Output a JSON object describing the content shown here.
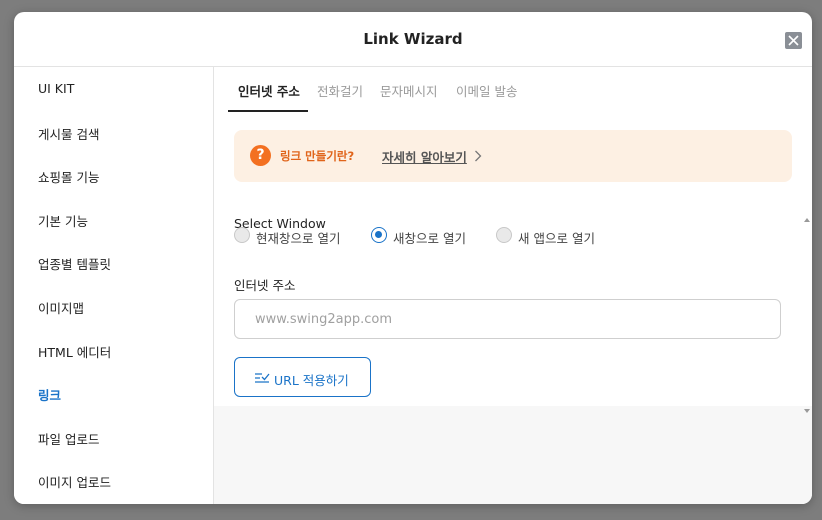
{
  "dialog": {
    "title": "Link Wizard",
    "close_icon": "close-icon"
  },
  "sidebar": {
    "items": [
      {
        "label": "UI KIT",
        "active": false
      },
      {
        "label": "게시물 검색",
        "active": false
      },
      {
        "label": "쇼핑몰 기능",
        "active": false
      },
      {
        "label": "기본 기능",
        "active": false
      },
      {
        "label": "업종별 템플릿",
        "active": false
      },
      {
        "label": "이미지맵",
        "active": false
      },
      {
        "label": "HTML 에디터",
        "active": false
      },
      {
        "label": "링크",
        "active": true
      },
      {
        "label": "파일 업로드",
        "active": false
      },
      {
        "label": "이미지 업로드",
        "active": false
      }
    ]
  },
  "tabs": [
    {
      "label": "인터넷 주소",
      "active": true
    },
    {
      "label": "전화걸기",
      "active": false
    },
    {
      "label": "문자메시지",
      "active": false
    },
    {
      "label": "이메일 발송",
      "active": false
    }
  ],
  "notice": {
    "icon": "question-icon",
    "text": "링크 만들기란?",
    "link": "자세히 알아보기",
    "chevron_icon": "chevron-right-icon"
  },
  "select_window": {
    "label": "Select Window",
    "options": [
      {
        "label": "현재창으로 열기",
        "checked": false
      },
      {
        "label": "새창으로 열기",
        "checked": true
      },
      {
        "label": "새 앱으로 열기",
        "checked": false
      }
    ]
  },
  "url": {
    "label": "인터넷 주소",
    "placeholder": "www.swing2app.com",
    "value": ""
  },
  "apply_button": {
    "label": "URL 적용하기",
    "icon": "link-apply-icon"
  },
  "colors": {
    "accent": "#1a73c8",
    "notice_bg": "#fdf0e3",
    "notice_accent": "#f37021"
  }
}
